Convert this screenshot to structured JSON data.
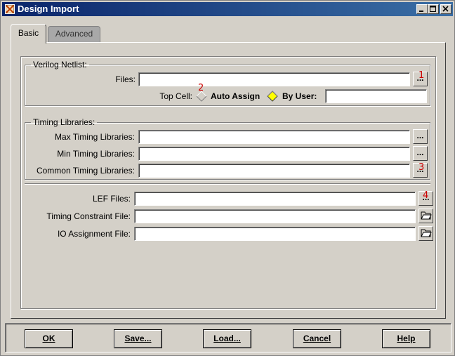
{
  "window": {
    "title": "Design Import",
    "minimize_label": "_",
    "maximize_label": "□",
    "close_label": "×"
  },
  "tabs": [
    {
      "label": "Basic",
      "active": true
    },
    {
      "label": "Advanced",
      "active": false
    }
  ],
  "verilog": {
    "legend": "Verilog Netlist:",
    "files_label": "Files:",
    "files_value": "",
    "files_button": "...",
    "top_cell_label": "Top Cell:",
    "auto_assign_label": "Auto Assign",
    "auto_assign_selected": false,
    "by_user_label": "By User:",
    "by_user_selected": true,
    "by_user_value": ""
  },
  "timing": {
    "legend": "Timing Libraries:",
    "max_label": "Max Timing Libraries:",
    "max_value": "",
    "min_label": "Min Timing Libraries:",
    "min_value": "",
    "common_label": "Common Timing Libraries:",
    "common_value": "",
    "button": "..."
  },
  "other": {
    "lef_label": "LEF Files:",
    "lef_value": "",
    "lef_button": "...",
    "constraint_label": "Timing Constraint File:",
    "constraint_value": "",
    "io_label": "IO Assignment File:",
    "io_value": ""
  },
  "annotations": [
    "1",
    "2",
    "3",
    "4"
  ],
  "buttons": {
    "ok": "OK",
    "save": "Save...",
    "load": "Load...",
    "cancel": "Cancel",
    "help": "Help"
  },
  "colors": {
    "titlebar_start": "#0a246a",
    "titlebar_end": "#3a6ea5",
    "annotation": "#cc0000",
    "radio_selected": "#ffff00"
  },
  "icons": {
    "app": "app-icon",
    "folder": "folder-open-icon",
    "radio_off": "diamond-radio-off-icon",
    "radio_on": "diamond-radio-on-icon"
  }
}
